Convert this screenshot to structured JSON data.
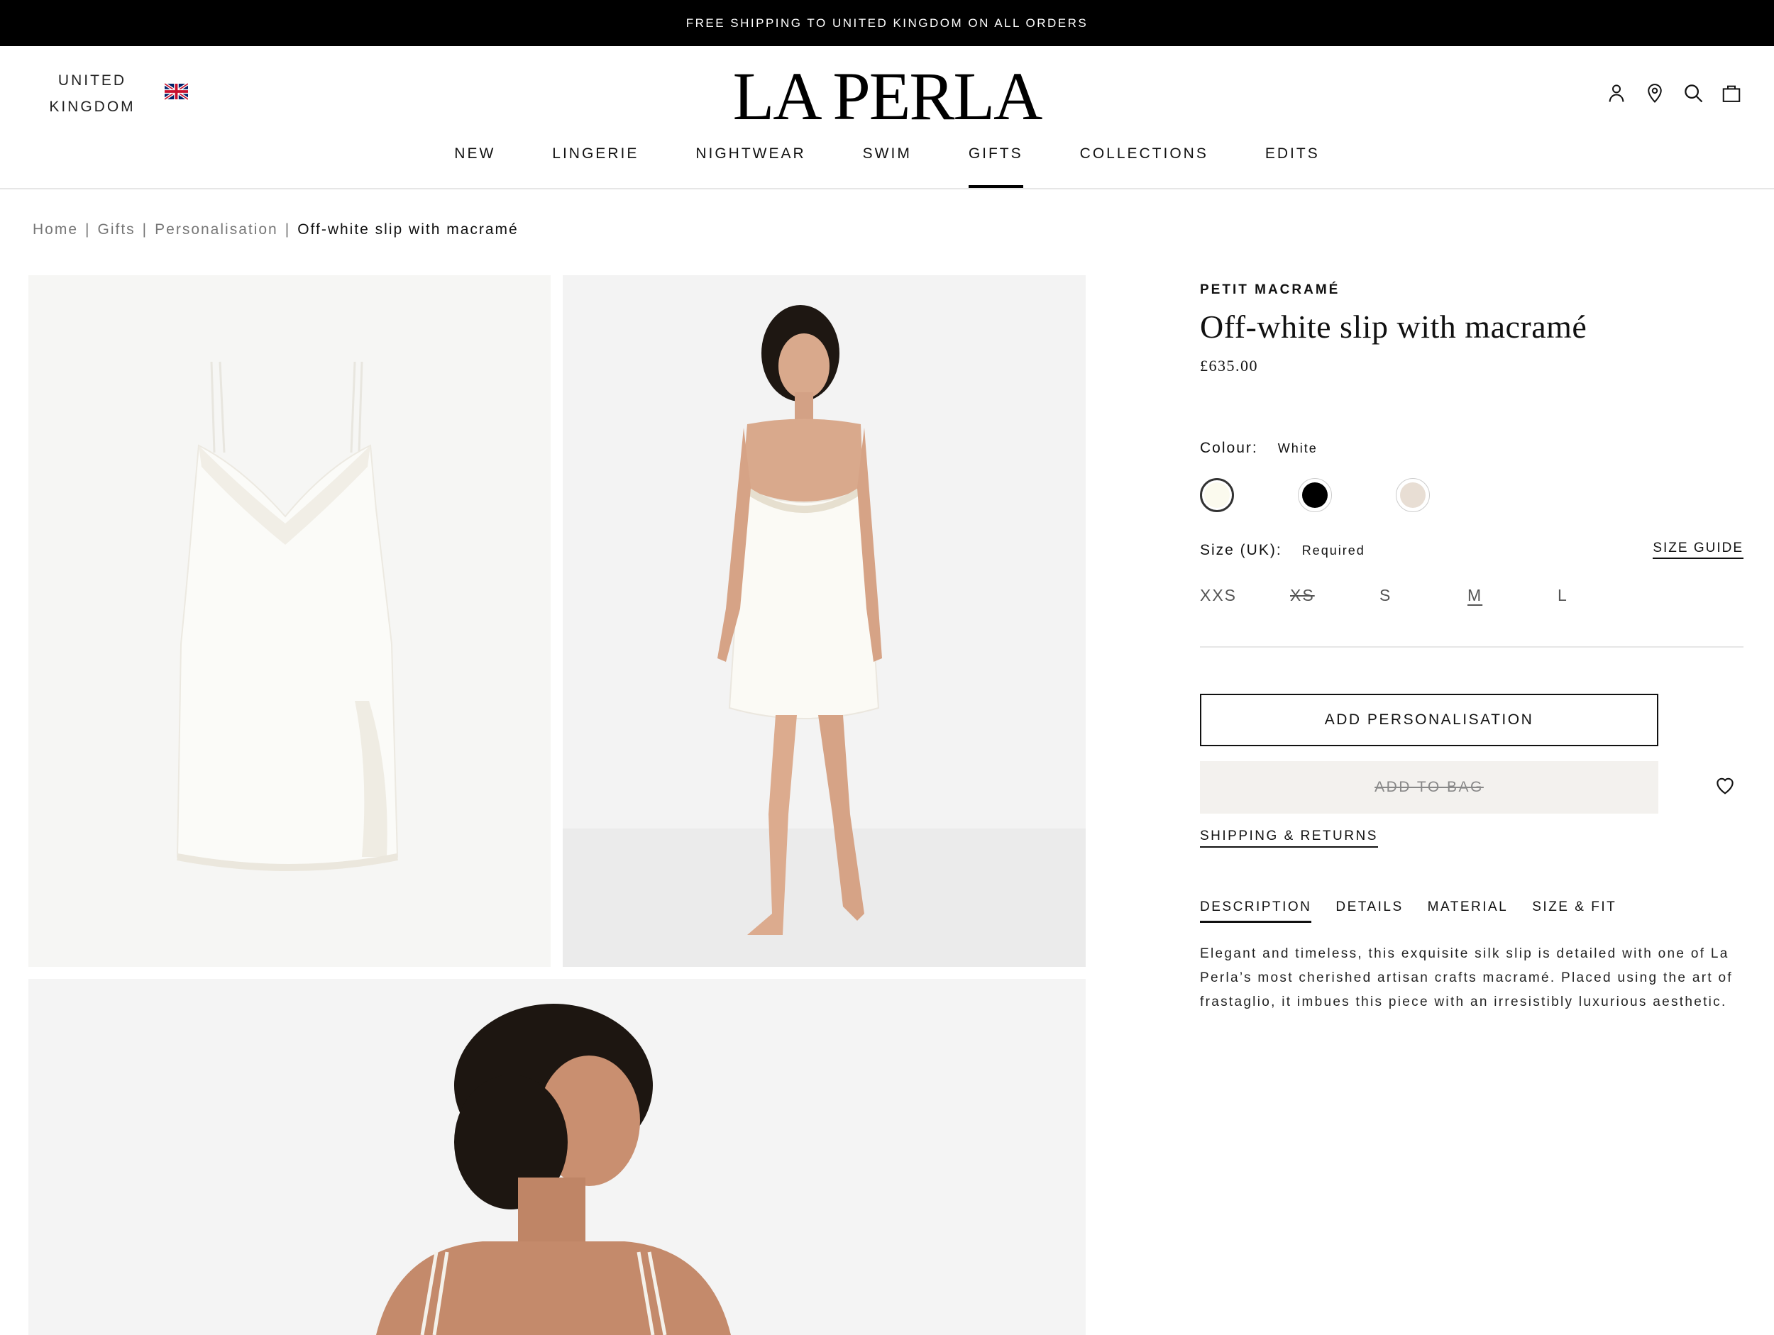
{
  "announcement": "FREE SHIPPING TO UNITED KINGDOM ON ALL ORDERS",
  "header": {
    "country_line1": "UNITED",
    "country_line2": "KINGDOM",
    "logo": "LA PERLA",
    "icons": [
      "account-icon",
      "store-locator-icon",
      "search-icon",
      "bag-icon"
    ]
  },
  "nav": {
    "items": [
      "NEW",
      "LINGERIE",
      "NIGHTWEAR",
      "SWIM",
      "GIFTS",
      "COLLECTIONS",
      "EDITS"
    ],
    "active": "GIFTS"
  },
  "breadcrumb": {
    "items": [
      "Home",
      "Gifts",
      "Personalisation"
    ],
    "current": "Off-white slip with macramé",
    "separator": "|"
  },
  "product": {
    "collection": "PETIT MACRAMÉ",
    "title": "Off-white slip with macramé",
    "price": "£635.00",
    "colour_label": "Colour:",
    "colour_value": "White",
    "swatches": [
      {
        "name": "White",
        "color": "#fbfaee",
        "selected": true
      },
      {
        "name": "Black",
        "color": "#000000",
        "selected": false
      },
      {
        "name": "Nude",
        "color": "#e8ded4",
        "selected": false
      }
    ],
    "size_label": "Size (UK):",
    "size_value": "Required",
    "size_guide": "SIZE GUIDE",
    "sizes": [
      {
        "label": "XXS",
        "state": "available"
      },
      {
        "label": "XS",
        "state": "unavailable"
      },
      {
        "label": "S",
        "state": "available"
      },
      {
        "label": "M",
        "state": "underline"
      },
      {
        "label": "L",
        "state": "available"
      }
    ],
    "add_personalisation": "ADD PERSONALISATION",
    "add_to_bag": "ADD TO BAG",
    "shipping_returns": "SHIPPING & RETURNS",
    "tabs": [
      "DESCRIPTION",
      "DETAILS",
      "MATERIAL",
      "SIZE & FIT"
    ],
    "active_tab": "DESCRIPTION",
    "description": "Elegant and timeless, this exquisite silk slip is detailed with one of La Perla’s most cherished artisan crafts macramé. Placed using the art of frastaglio, it imbues this piece with an irresistibly luxurious aesthetic."
  }
}
